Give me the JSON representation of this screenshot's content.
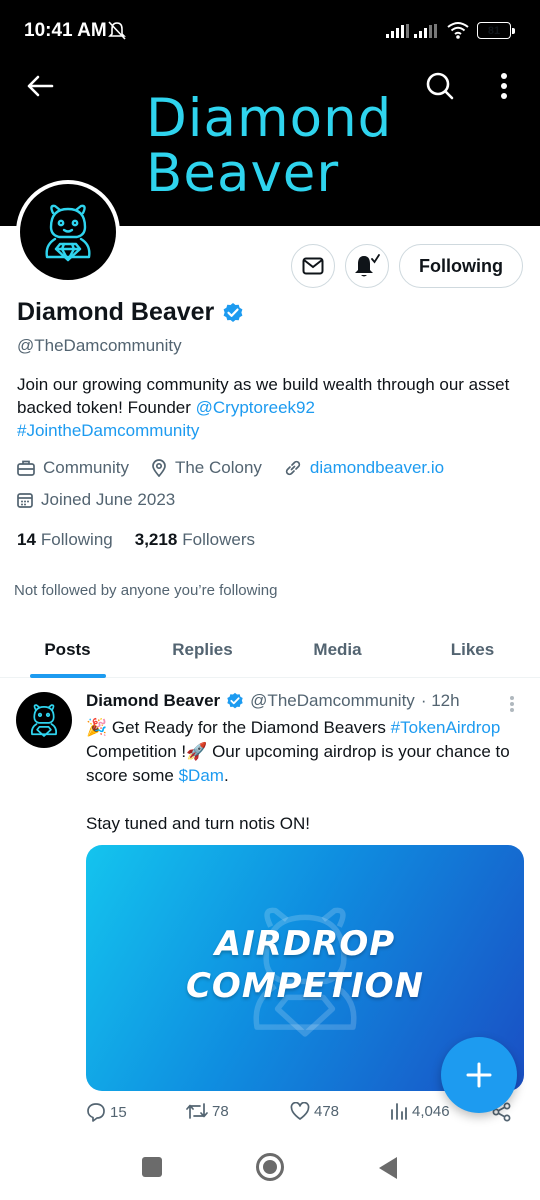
{
  "status_bar": {
    "time": "10:41 AM",
    "battery": "81"
  },
  "banner": {
    "line1": "Diamond",
    "line2": "Beaver"
  },
  "actions": {
    "following_label": "Following"
  },
  "profile": {
    "display_name": "Diamond Beaver",
    "handle": "@TheDamcommunity",
    "bio": {
      "text1": "Join our growing community as we build wealth through our asset backed token! Founder ",
      "mention": "@Cryptoreek92",
      "hashtag": "#JointheDamcommunity"
    },
    "category": "Community",
    "location": "The Colony",
    "website": "diamondbeaver.io",
    "joined": "Joined June 2023",
    "following_count": "14",
    "following_label": "Following",
    "followers_count": "3,218",
    "followers_label": "Followers",
    "not_followed": "Not followed by anyone you’re following"
  },
  "tabs": [
    {
      "label": "Posts",
      "active": true
    },
    {
      "label": "Replies",
      "active": false
    },
    {
      "label": "Media",
      "active": false
    },
    {
      "label": "Likes",
      "active": false
    }
  ],
  "post": {
    "author": "Diamond Beaver",
    "handle": "@TheDamcommunity",
    "time": "· 12h",
    "emoji1": "🎉",
    "text1": " Get Ready for the Diamond Beavers ",
    "hashtag": "#TokenAirdrop",
    "text2": " Competition !",
    "emoji2": "🚀",
    "text3": " Our upcoming airdrop is your chance to score some ",
    "cashtag": "$Dam",
    "text4": ".",
    "line2": "Stay tuned and turn notis ON!",
    "media_line1": "AIRDROP",
    "media_line2": "COMPETION",
    "replies": "15",
    "reposts": "78",
    "likes": "478",
    "views": "4,046"
  },
  "colors": {
    "accent": "#1d9bf0",
    "banner_text": "#2fd4ee",
    "muted": "#536471"
  }
}
